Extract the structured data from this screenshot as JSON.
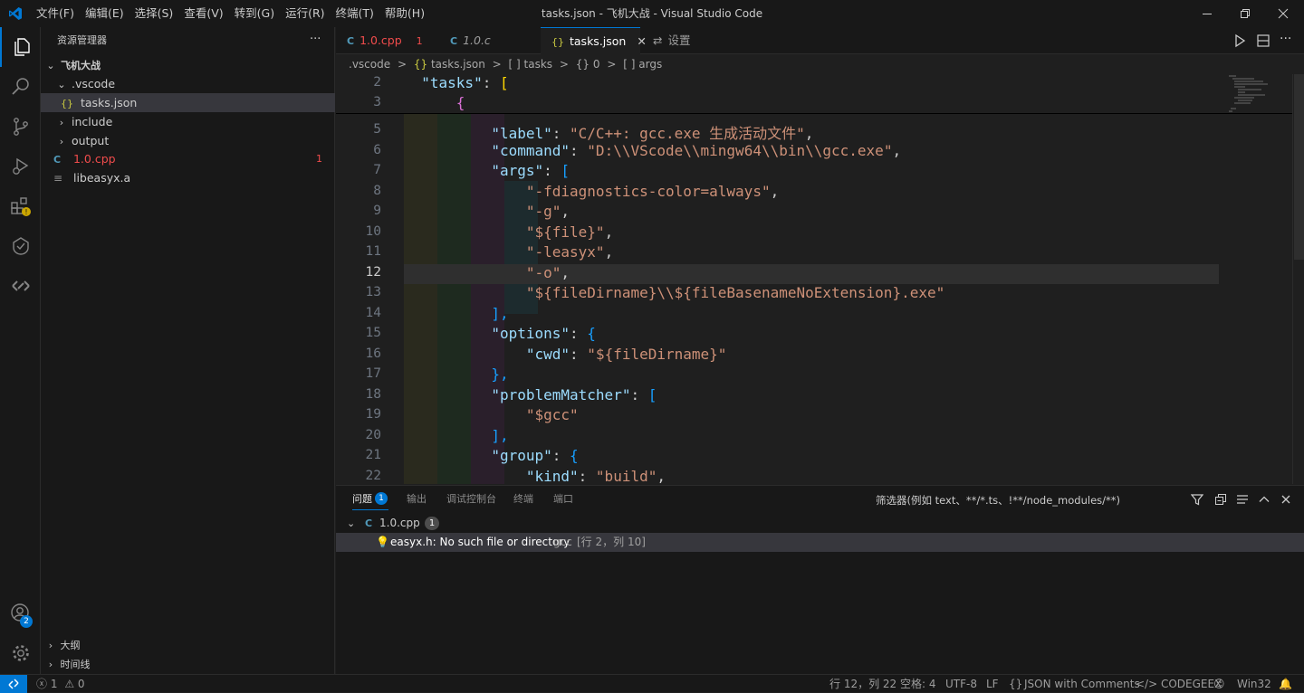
{
  "window": {
    "title": "tasks.json - 飞机大战 - Visual Studio Code"
  },
  "menu": [
    "文件(F)",
    "编辑(E)",
    "选择(S)",
    "查看(V)",
    "转到(G)",
    "运行(R)",
    "终端(T)",
    "帮助(H)"
  ],
  "sidebar": {
    "header": "资源管理器",
    "more": "···",
    "tree": {
      "root": "飞机大战",
      "vscode": ".vscode",
      "tasks": "tasks.json",
      "include": "include",
      "output": "output",
      "cpp": "1.0.cpp",
      "cpp_badge": "1",
      "lib": "libeasyx.a"
    },
    "outline": "大纲",
    "timeline": "时间线"
  },
  "tabs": [
    {
      "label": "1.0.cpp",
      "badge": "1"
    },
    {
      "label": "1.0.c"
    },
    {
      "label": "tasks.json"
    },
    {
      "label": "设置"
    }
  ],
  "breadcrumb": {
    "a": ".vscode",
    "b": "tasks.json",
    "c": "tasks",
    "d": "0",
    "e": "args",
    "sep": ">",
    "obj_icon": "{}",
    "arr_icon": "[ ]",
    "json_icon": "{}"
  },
  "editor": {
    "current_line": 12,
    "sticky": [
      {
        "n": "2",
        "text": "    \"tasks\": ["
      },
      {
        "n": "3",
        "text": "        {"
      }
    ],
    "lines": [
      {
        "n": "5",
        "key": "\"label\"",
        "val": "\"C/C++: gcc.exe 生成活动文件\"",
        "tail": ","
      },
      {
        "n": "6",
        "key": "\"command\"",
        "val": "\"D:\\\\VScode\\\\mingw64\\\\bin\\\\gcc.exe\"",
        "tail": ","
      },
      {
        "n": "7",
        "key": "\"args\"",
        "val": "",
        "tail": "["
      },
      {
        "n": "8",
        "key": "",
        "val": "\"-fdiagnostics-color=always\"",
        "tail": ","
      },
      {
        "n": "9",
        "key": "",
        "val": "\"-g\"",
        "tail": ","
      },
      {
        "n": "10",
        "key": "",
        "val": "\"${file}\"",
        "tail": ","
      },
      {
        "n": "11",
        "key": "",
        "val": "\"-leasyx\"",
        "tail": ","
      },
      {
        "n": "12",
        "key": "",
        "val": "\"-o\"",
        "tail": ","
      },
      {
        "n": "13",
        "key": "",
        "val": "\"${fileDirname}\\\\${fileBasenameNoExtension}.exe\"",
        "tail": ""
      },
      {
        "n": "14",
        "key": "",
        "val": "",
        "tail": "],"
      },
      {
        "n": "15",
        "key": "\"options\"",
        "val": "",
        "tail": "{"
      },
      {
        "n": "16",
        "key": "\"cwd\"",
        "val": "\"${fileDirname}\"",
        "tail": ""
      },
      {
        "n": "17",
        "key": "",
        "val": "",
        "tail": "},"
      },
      {
        "n": "18",
        "key": "\"problemMatcher\"",
        "val": "",
        "tail": "["
      },
      {
        "n": "19",
        "key": "",
        "val": "\"$gcc\"",
        "tail": ""
      },
      {
        "n": "20",
        "key": "",
        "val": "",
        "tail": "],"
      },
      {
        "n": "21",
        "key": "\"group\"",
        "val": "",
        "tail": "{"
      },
      {
        "n": "22",
        "key": "\"kind\"",
        "val": "\"build\"",
        "tail": ","
      }
    ]
  },
  "panel": {
    "tabs": [
      "问题",
      "输出",
      "调试控制台",
      "终端",
      "端口"
    ],
    "problems_count": "1",
    "filter_placeholder": "筛选器(例如 text、**/*.ts、!**/node_modules/**)",
    "file": "1.0.cpp",
    "file_count": "1",
    "error_msg": "easyx.h: No such file or directory",
    "error_src": "gcc",
    "error_loc": "[行 2，列 10]"
  },
  "activity": {
    "accounts_badge": "2"
  },
  "status": {
    "errors": "1",
    "warnings": "0",
    "position": "行 12，列 22",
    "spaces": "空格: 4",
    "encoding": "UTF-8",
    "eol": "LF",
    "braces": "{}",
    "language": "JSON with Comments",
    "codegeex": "CODEGEEX",
    "platform": "Win32"
  },
  "colors": {
    "accent": "#0078d4",
    "error": "#f14c4c",
    "warning": "#cca700",
    "badge": "#0078d4",
    "string": "#ce9178",
    "key": "#9cdcfe"
  }
}
